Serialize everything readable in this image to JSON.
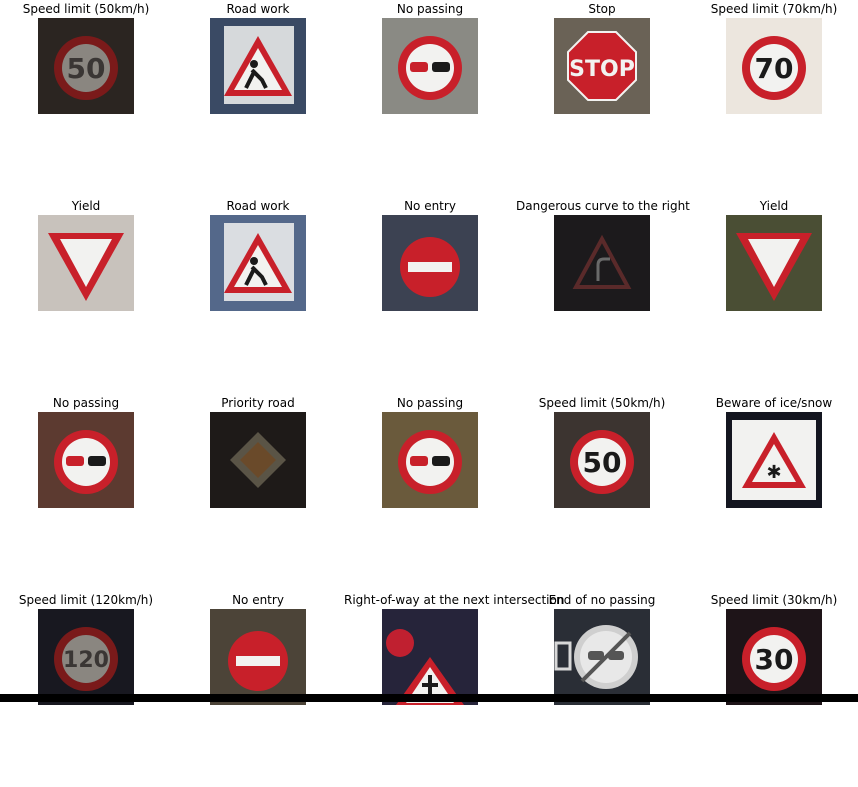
{
  "images": [
    {
      "title": "Speed limit (50km/h)",
      "sign": "speed",
      "text": "50",
      "bg": "#2b2521",
      "dim": true
    },
    {
      "title": "Road work",
      "sign": "roadwork",
      "bg": "#3a4a64"
    },
    {
      "title": "No passing",
      "sign": "nopassing",
      "bg": "#8a8a84"
    },
    {
      "title": "Stop",
      "sign": "stop",
      "text": "STOP",
      "bg": "#6a6256"
    },
    {
      "title": "Speed limit (70km/h)",
      "sign": "speed",
      "text": "70",
      "bg": "#ece6de"
    },
    {
      "title": "Yield",
      "sign": "yield",
      "bg": "#c8c2bc"
    },
    {
      "title": "Road work",
      "sign": "roadwork",
      "bg": "#54688a"
    },
    {
      "title": "No entry",
      "sign": "noentry",
      "bg": "#3c4252"
    },
    {
      "title": "Dangerous curve to the right",
      "sign": "curve",
      "bg": "#1c1a1c",
      "dim": true
    },
    {
      "title": "Yield",
      "sign": "yield",
      "bg": "#4a4e34"
    },
    {
      "title": "No passing",
      "sign": "nopassing",
      "bg": "#5c3a30"
    },
    {
      "title": "Priority road",
      "sign": "priority",
      "bg": "#1e1a18",
      "dim": true
    },
    {
      "title": "No passing",
      "sign": "nopassing",
      "bg": "#6a5a3c"
    },
    {
      "title": "Speed limit (50km/h)",
      "sign": "speed",
      "text": "50",
      "bg": "#3c3430"
    },
    {
      "title": "Beware of ice/snow",
      "sign": "ice",
      "bg": "#141620"
    },
    {
      "title": "Speed limit (120km/h)",
      "sign": "speed",
      "text": "120",
      "bg": "#181820",
      "dim": true
    },
    {
      "title": "No entry",
      "sign": "noentry",
      "bg": "#4c4438"
    },
    {
      "title": "Right-of-way at the next intersection",
      "sign": "rightofway",
      "bg": "#26243a"
    },
    {
      "title": "End of no passing",
      "sign": "endnopassing",
      "bg": "#2a2e36"
    },
    {
      "title": "Speed limit (30km/h)",
      "sign": "speed",
      "text": "30",
      "bg": "#1e1418"
    }
  ]
}
